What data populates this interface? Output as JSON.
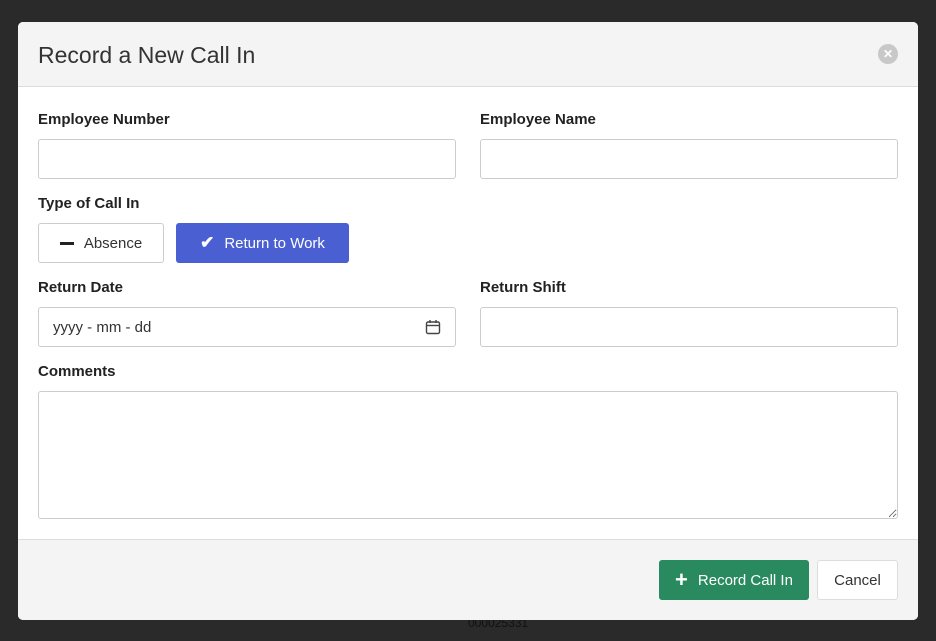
{
  "background": {
    "partial_text": "000025331"
  },
  "modal": {
    "title": "Record a New Call In",
    "close_icon": "close-circle-icon",
    "fields": {
      "employee_number": {
        "label": "Employee Number",
        "value": ""
      },
      "employee_name": {
        "label": "Employee Name",
        "value": ""
      },
      "type_of_call_in": {
        "label": "Type of Call In",
        "options": [
          {
            "label": "Absence",
            "icon": "minus-icon",
            "selected": false
          },
          {
            "label": "Return to Work",
            "icon": "check-icon",
            "selected": true
          }
        ]
      },
      "return_date": {
        "label": "Return Date",
        "placeholder": "yyyy - mm - dd",
        "icon": "calendar-icon"
      },
      "return_shift": {
        "label": "Return Shift",
        "value": ""
      },
      "comments": {
        "label": "Comments",
        "value": ""
      }
    },
    "footer": {
      "submit_label": "Record Call In",
      "submit_icon": "plus-icon",
      "cancel_label": "Cancel"
    }
  },
  "colors": {
    "primary": "#4a5fd1",
    "success": "#2a8a5f",
    "overlay": "#2a2a2a"
  }
}
